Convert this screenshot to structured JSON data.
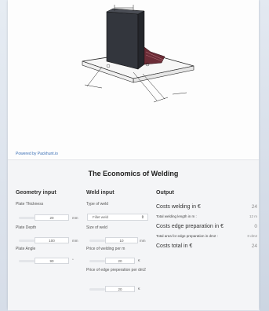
{
  "viewer": {
    "powered_by": "Powered by Packhunt.io"
  },
  "title": "The Economics of Welding",
  "geometry": {
    "heading": "Geometry input",
    "thickness": {
      "label": "Plate Thickness",
      "value": "20",
      "unit": "mm"
    },
    "depth": {
      "label": "Plate Depth",
      "value": "100",
      "unit": "mm"
    },
    "angle": {
      "label": "Plate Angle",
      "value": "90",
      "unit": "°"
    }
  },
  "weld": {
    "heading": "Weld input",
    "type": {
      "label": "Type of weld",
      "value": "Fillet weld"
    },
    "size": {
      "label": "Size of weld",
      "value": "10",
      "unit": "mm"
    },
    "price_weld": {
      "label": "Price of welding per m",
      "value": "20",
      "unit": "€"
    },
    "price_edge": {
      "label": "Price of edge preperation per dm2",
      "value": "20",
      "unit": "€"
    }
  },
  "output": {
    "heading": "Output",
    "costs_welding": {
      "label": "Costs welding in €",
      "value": "24"
    },
    "total_length": {
      "label": "Total welding length in m :",
      "value": "12 m"
    },
    "costs_edge": {
      "label": "Costs edge preparation in €",
      "value": "0"
    },
    "total_area": {
      "label": "Total area for edge preparation in dm2 :",
      "value": "0 dm2"
    },
    "costs_total": {
      "label": "Costs total in €",
      "value": "24"
    }
  },
  "colors": {
    "plate": "#3a3d44",
    "weld": "#6b2c36",
    "link": "#3a6fb5"
  }
}
